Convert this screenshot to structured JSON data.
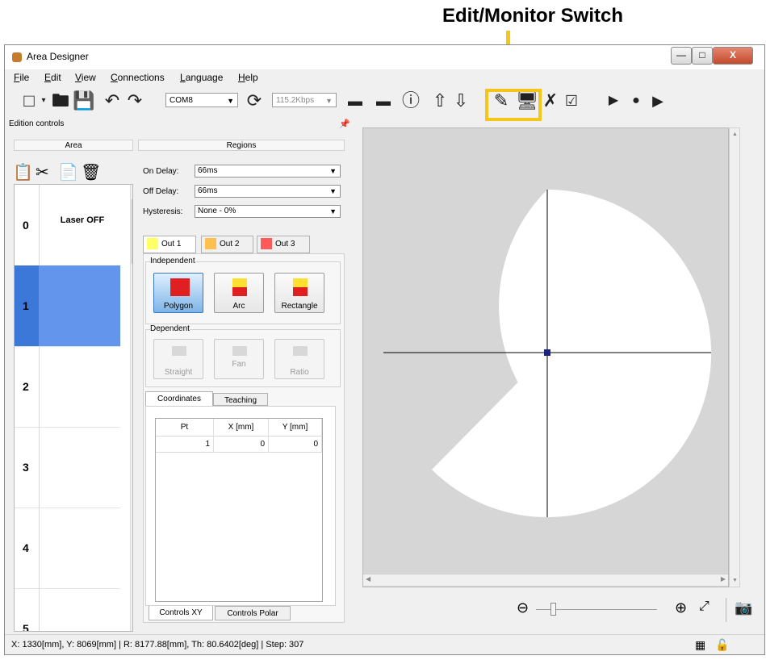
{
  "annotation": {
    "label": "Edit/Monitor Switch",
    "color": "#f5c518"
  },
  "window": {
    "title": "Area Designer",
    "buttons": {
      "minimize": "—",
      "maximize": "□",
      "close": "X"
    }
  },
  "menu": [
    {
      "label": "File",
      "underline": "F",
      "rest": "ile"
    },
    {
      "label": "Edit",
      "underline": "E",
      "rest": "dit"
    },
    {
      "label": "View",
      "underline": "V",
      "rest": "iew"
    },
    {
      "label": "Connections",
      "underline": "C",
      "rest": "onnections"
    },
    {
      "label": "Language",
      "underline": "L",
      "rest": "anguage"
    },
    {
      "label": "Help",
      "underline": "H",
      "rest": "elp"
    }
  ],
  "toolbar": {
    "port": "COM8",
    "baud": "115.2Kbps",
    "icons": [
      "new-file-icon",
      "open-folder-icon",
      "save-icon",
      "undo-icon",
      "redo-icon",
      "refresh-icon",
      "upload-icon",
      "download-icon",
      "info-icon",
      "edit-mode-icon",
      "monitor-mode-icon",
      "tools-icon",
      "checklist-icon",
      "play-icon",
      "record-icon",
      "play-file-icon"
    ]
  },
  "panel": {
    "title": "Edition controls",
    "pin": "⏸"
  },
  "tabs": {
    "area": "Area",
    "regions": "Regions"
  },
  "areas": [
    {
      "num": "0",
      "name": "Laser OFF",
      "selected": false
    },
    {
      "num": "1",
      "name": "",
      "selected": true
    },
    {
      "num": "2",
      "name": "",
      "selected": false
    },
    {
      "num": "3",
      "name": "",
      "selected": false
    },
    {
      "num": "4",
      "name": "",
      "selected": false
    },
    {
      "num": "5",
      "name": "",
      "selected": false
    }
  ],
  "regions": {
    "on_delay_label": "On Delay:",
    "on_delay_value": "66ms",
    "off_delay_label": "Off Delay:",
    "off_delay_value": "66ms",
    "hysteresis_label": "Hysteresis:",
    "hysteresis_value": "None  - 0%"
  },
  "out_tabs": [
    {
      "label": "Out 1",
      "color": "#ffff66"
    },
    {
      "label": "Out 2",
      "color": "#ffc04d"
    },
    {
      "label": "Out 3",
      "color": "#ff5a5a"
    }
  ],
  "independent": {
    "label": "Independent",
    "buttons": [
      "Polygon",
      "Arc",
      "Rectangle"
    ]
  },
  "dependent": {
    "label": "Dependent",
    "buttons": [
      "Straight",
      "Fan",
      "Ratio"
    ]
  },
  "coord_tabs": {
    "coordinates": "Coordinates",
    "teaching": "Teaching"
  },
  "coord_table": {
    "headers": [
      "Pt",
      "X [mm]",
      "Y [mm]"
    ],
    "rows": [
      [
        "1",
        "0",
        "0"
      ]
    ]
  },
  "bottom_tabs": {
    "xy": "Controls XY",
    "polar": "Controls Polar"
  },
  "status": "X: 1330[mm], Y: 8069[mm] | R: 8177.88[mm], Th: 80.6402[deg] | Step: 307"
}
